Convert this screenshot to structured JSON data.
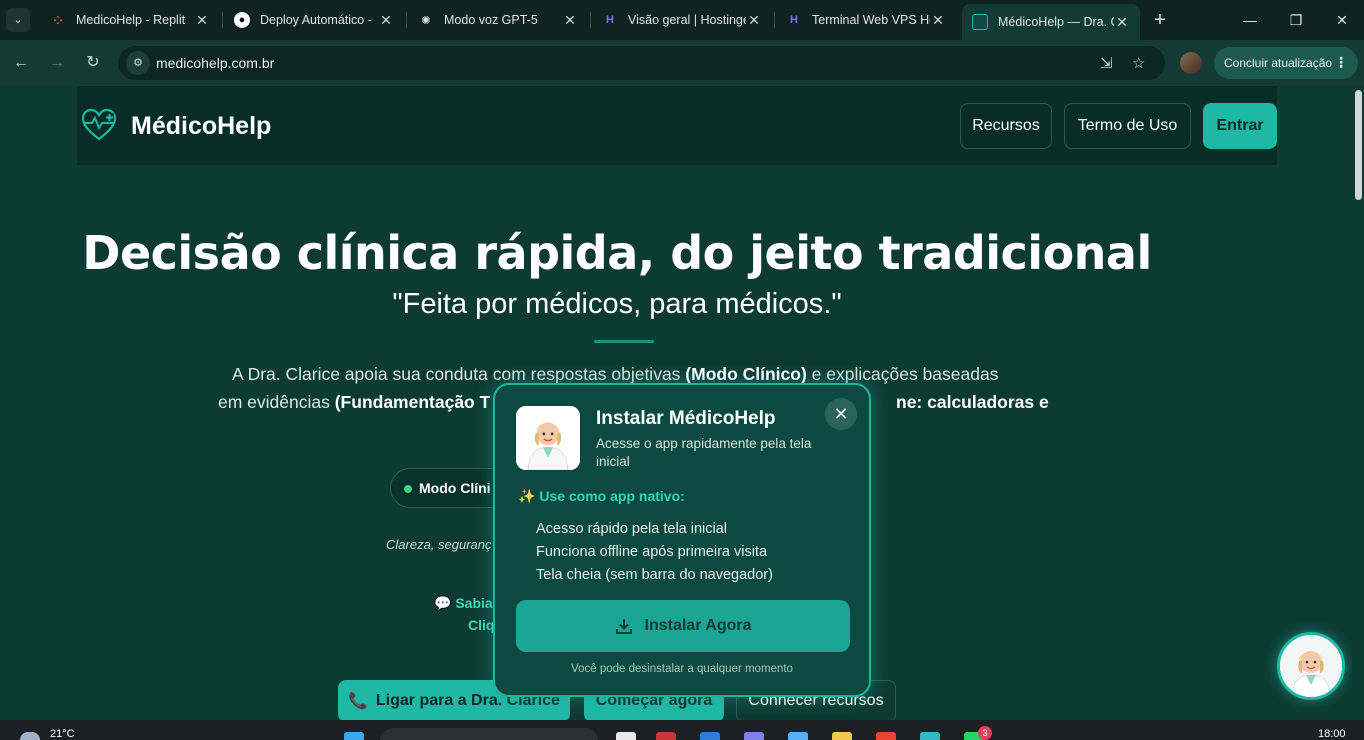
{
  "browser": {
    "tabs": [
      {
        "title": "MedicoHelp - Replit",
        "icon": "replit-icon"
      },
      {
        "title": "Deploy Automático -",
        "icon": "github-icon"
      },
      {
        "title": "Modo voz GPT-5",
        "icon": "openai-icon"
      },
      {
        "title": "Visão geral | Hostinge",
        "icon": "hostinger-icon"
      },
      {
        "title": "Terminal Web VPS Ho",
        "icon": "hostinger-icon"
      },
      {
        "title": "MédicoHelp — Dra. C",
        "icon": "medicohelp-icon"
      }
    ],
    "url": "medicohelp.com.br",
    "update_label": "Concluir atualização"
  },
  "site": {
    "brand": "MédicoHelp",
    "nav": {
      "recursos": "Recursos",
      "termo": "Termo de Uso",
      "entrar": "Entrar"
    },
    "hero": {
      "title": "Decisão clínica rápida, do jeito tradicional",
      "subtitle": "\"Feita por médicos, para médicos.\"",
      "desc1_a": "A Dra. Clarice apoia sua conduta com respostas objetivas ",
      "desc1_b": "(Modo Clínico)",
      "desc1_c": " e explicações baseadas",
      "desc2_a": "em evidências ",
      "desc2_b": "(Fundamentação T",
      "desc3": "ne: calculadoras e"
    },
    "mode_pill": "Modo Clíni",
    "clareza": "Clareza, seguranç",
    "sabia": "Sabia",
    "cliq": "Cliq",
    "cta": {
      "call": "Ligar para a Dra. Clarice",
      "start": "Começar agora",
      "know": "Conhecer recursos"
    }
  },
  "install_modal": {
    "title": "Instalar MédicoHelp",
    "description": "Acesse o app rapidamente pela tela inicial",
    "native_heading": "Use como app nativo:",
    "features": [
      "Acesso rápido pela tela inicial",
      "Funciona offline após primeira visita",
      "Tela cheia (sem barra do navegador)"
    ],
    "install_label": "Instalar Agora",
    "note": "Você pode desinstalar a qualquer momento"
  },
  "taskbar": {
    "temperature": "21°C",
    "clock": "18:00",
    "badge": "3"
  },
  "colors": {
    "accent": "#1fb8a4",
    "page_bg": "#0d3b34",
    "navbar_bg": "#082d27",
    "modal_bg": "#0c4a41"
  }
}
